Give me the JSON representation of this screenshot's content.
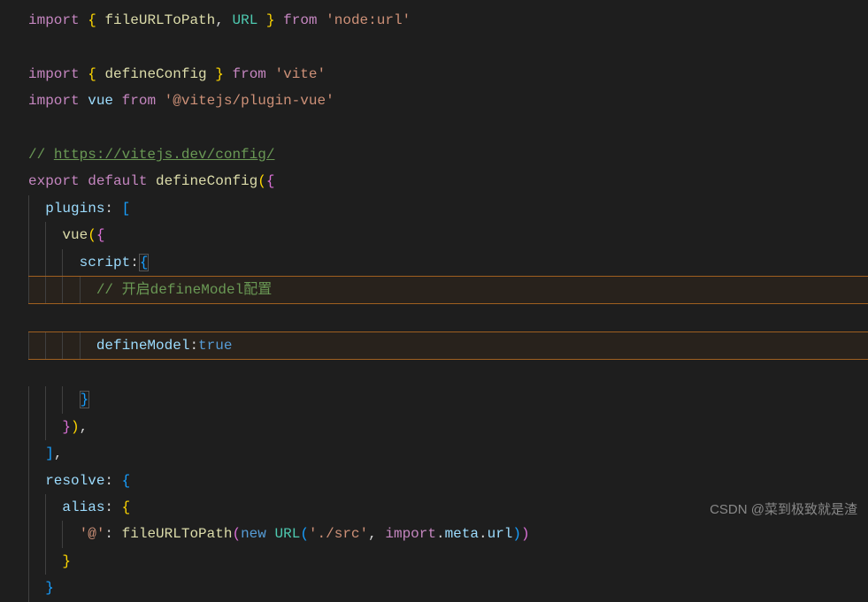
{
  "code": {
    "line1": {
      "import": "import",
      "brace_open": "{",
      "fn1": "fileURLToPath",
      "comma": ",",
      "cls1": "URL",
      "brace_close": "}",
      "from": "from",
      "str": "'node:url'"
    },
    "line3": {
      "import": "import",
      "brace_open": "{",
      "fn": "defineConfig",
      "brace_close": "}",
      "from": "from",
      "str": "'vite'"
    },
    "line4": {
      "import": "import",
      "prop": "vue",
      "from": "from",
      "str": "'@vitejs/plugin-vue'"
    },
    "line6_comment": "// ",
    "line6_link": "https://vitejs.dev/config/",
    "line7": {
      "export": "export",
      "default": "default",
      "fn": "defineConfig",
      "paren": "(",
      "brace": "{"
    },
    "plugins_label": "plugins",
    "vue_call": "vue",
    "script_label": "script",
    "comment_inner": "// 开启defineModel配置",
    "defineModel_label": "defineModel",
    "true_val": "true",
    "resolve_label": "resolve",
    "alias_label": "alias",
    "alias_key": "'@'",
    "fileURLToPath": "fileURLToPath",
    "new_kw": "new",
    "URL_cls": "URL",
    "src_str": "'./src'",
    "import_kw": "import",
    "meta_prop": "meta",
    "url_prop": "url"
  },
  "watermark": "CSDN @菜到极致就是渣"
}
